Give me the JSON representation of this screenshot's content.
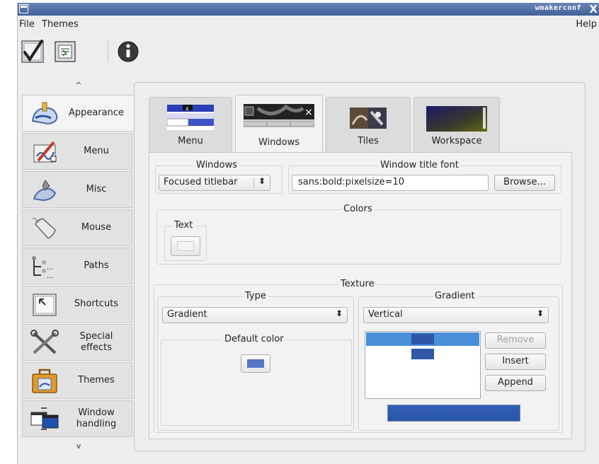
{
  "window": {
    "title": "wmakerconf",
    "close_glyph": "X"
  },
  "menubar": {
    "file": "File",
    "themes": "Themes",
    "help": "Help"
  },
  "toolbar": {
    "items": [
      {
        "icon": "checkmark-icon",
        "tooltip": ""
      },
      {
        "icon": "document-icon",
        "tooltip": ""
      },
      {
        "icon": "info-icon",
        "tooltip": ""
      }
    ]
  },
  "sidebar": {
    "up_arrow": "^",
    "down_arrow": "v",
    "items": [
      {
        "label": "Appearance",
        "icon": "paint-hand-icon",
        "active": true
      },
      {
        "label": "Menu",
        "icon": "menu-editor-icon",
        "active": false
      },
      {
        "label": "Misc",
        "icon": "wrench-icon",
        "active": false
      },
      {
        "label": "Mouse",
        "icon": "mouse-icon",
        "active": false
      },
      {
        "label": "Paths",
        "icon": "paths-icon",
        "active": false
      },
      {
        "label": "Shortcuts",
        "icon": "shortcut-key-icon",
        "active": false
      },
      {
        "label": "Special\neffects",
        "icon": "tools-icon",
        "active": false
      },
      {
        "label": "Themes",
        "icon": "briefcase-icon",
        "active": false
      },
      {
        "label": "Window\nhandling",
        "icon": "window-handling-icon",
        "active": false
      }
    ]
  },
  "tabs": [
    {
      "label": "Menu",
      "active": false
    },
    {
      "label": "Windows",
      "active": true
    },
    {
      "label": "Tiles",
      "active": false
    },
    {
      "label": "Workspace",
      "active": false
    }
  ],
  "windows_group": {
    "label": "Windows",
    "select_value": "Focused titlebar",
    "select_arrow": "↕"
  },
  "font_group": {
    "label": "Window title font",
    "value": "sans:bold:pixelsize=10",
    "browse": "Browse..."
  },
  "colors_group": {
    "label": "Colors",
    "text_label": "Text",
    "text_color": "#f4f4f4"
  },
  "texture_group": {
    "label": "Texture",
    "type_label": "Type",
    "type_value": "Gradient",
    "gradient_label": "Gradient",
    "gradient_value": "Vertical",
    "default_color_label": "Default color",
    "default_color": "#5577c4",
    "gradient_colors": [
      "#2e57a8",
      "#2e57a8"
    ],
    "remove": "Remove",
    "insert": "Insert",
    "append": "Append"
  },
  "colors": {
    "accent": "#4a90d9",
    "titlebar": "#4a6aa3",
    "gradient_blue": "#2e57a8"
  }
}
